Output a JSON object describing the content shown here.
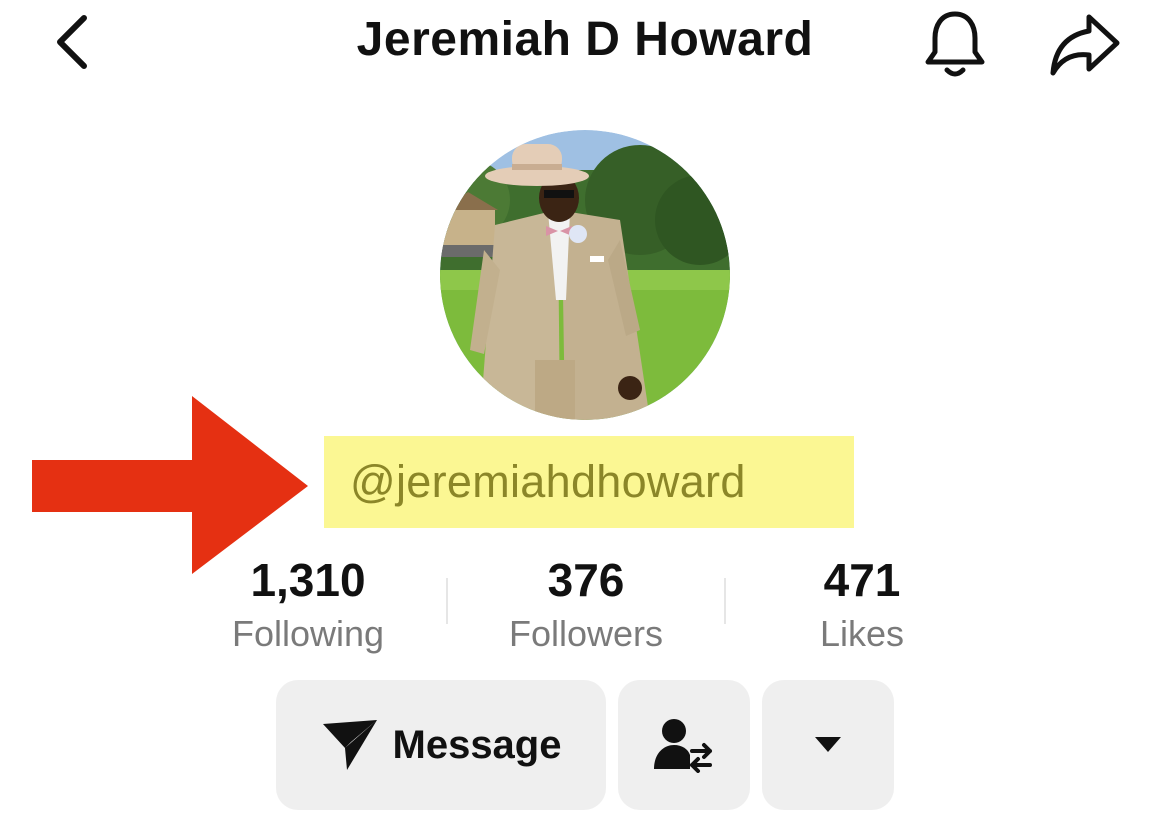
{
  "header": {
    "title": "Jeremiah D Howard",
    "back_icon": "chevron-left-icon",
    "bell_icon": "bell-icon",
    "share_icon": "share-arrow-icon"
  },
  "profile": {
    "avatar_icon": "profile-photo",
    "username": "@jeremiahdhoward",
    "highlight_color": "#fbf793",
    "annotation_arrow_color": "#e53012"
  },
  "stats": [
    {
      "value": "1,310",
      "label": "Following"
    },
    {
      "value": "376",
      "label": "Followers"
    },
    {
      "value": "471",
      "label": "Likes"
    }
  ],
  "actions": {
    "message_label": "Message",
    "message_icon": "send-icon",
    "friend_icon": "user-swap-icon",
    "more_icon": "caret-down-icon"
  }
}
